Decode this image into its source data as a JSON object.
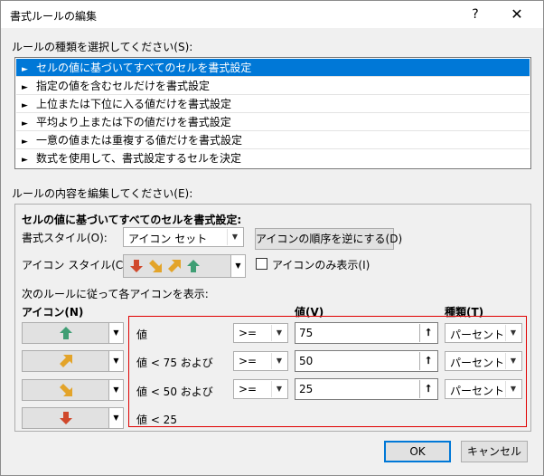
{
  "window": {
    "title": "書式ルールの編集",
    "help_glyph": "?",
    "close_glyph": "✕"
  },
  "rule_type": {
    "label": "ルールの種類を選択してください(S):",
    "items": [
      "セルの値に基づいてすべてのセルを書式設定",
      "指定の値を含むセルだけを書式設定",
      "上位または下位に入る値だけを書式設定",
      "平均より上または下の値だけを書式設定",
      "一意の値または重複する値だけを書式設定",
      "数式を使用して、書式設定するセルを決定"
    ],
    "selected_index": 0
  },
  "rule_edit": {
    "label": "ルールの内容を編集してください(E):",
    "heading": "セルの値に基づいてすべてのセルを書式設定:",
    "format_style_label": "書式スタイル(O):",
    "format_style_value": "アイコン セット",
    "reverse_button": "アイコンの順序を逆にする(D)",
    "icon_style_label": "アイコン スタイル(C):",
    "icon_only_label": "アイコンのみ表示(I)",
    "icon_only_checked": false,
    "rule_hint": "次のルールに従って各アイコンを表示:",
    "col_icon": "アイコン(N)",
    "col_value": "値(V)",
    "col_type": "種類(T)",
    "rows": [
      {
        "icon": "green-up-arrow-icon",
        "condition": "値",
        "operator": ">=",
        "value": "75",
        "type": "パーセント"
      },
      {
        "icon": "yellow-up-right-arrow-icon",
        "condition": "値 < 75 および",
        "operator": ">=",
        "value": "50",
        "type": "パーセント"
      },
      {
        "icon": "yellow-down-right-arrow-icon",
        "condition": "値 < 50 および",
        "operator": ">=",
        "value": "25",
        "type": "パーセント"
      },
      {
        "icon": "red-down-arrow-icon",
        "condition": "値 < 25"
      }
    ]
  },
  "buttons": {
    "ok": "OK",
    "cancel": "キャンセル"
  },
  "colors": {
    "selection": "#0078d7",
    "highlight_frame": "#e00000",
    "arrow_green": "#3f9e74",
    "arrow_yellow": "#e3a42a",
    "arrow_red": "#d0482b"
  }
}
